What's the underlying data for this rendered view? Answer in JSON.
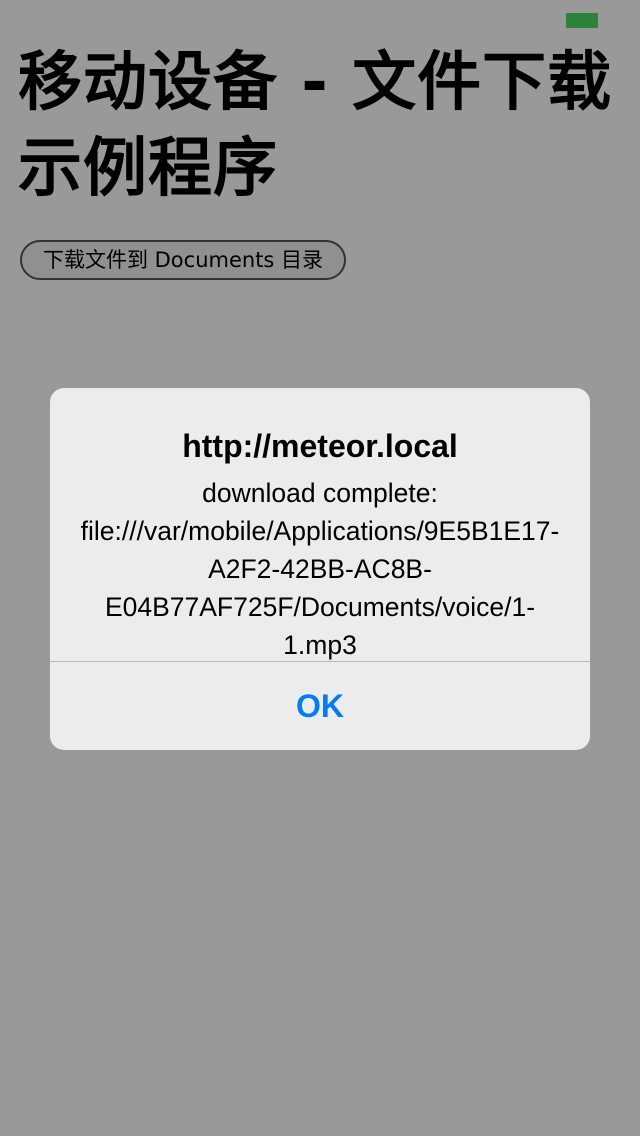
{
  "status_bar": {
    "battery_color": "#4cd964",
    "battery_icon": "battery-icon"
  },
  "page": {
    "title": "移动设备 - 文件下载示例程序",
    "download_button_label": "下载文件到 Documents 目录"
  },
  "alert": {
    "title": "http://meteor.local",
    "message": "download complete: file:///var/mobile/Applications/9E5B1E17-A2F2-42BB-AC8B-E04B77AF725F/Documents/voice/1-1.mp3",
    "ok_label": "OK",
    "accent_color": "#007aff"
  }
}
